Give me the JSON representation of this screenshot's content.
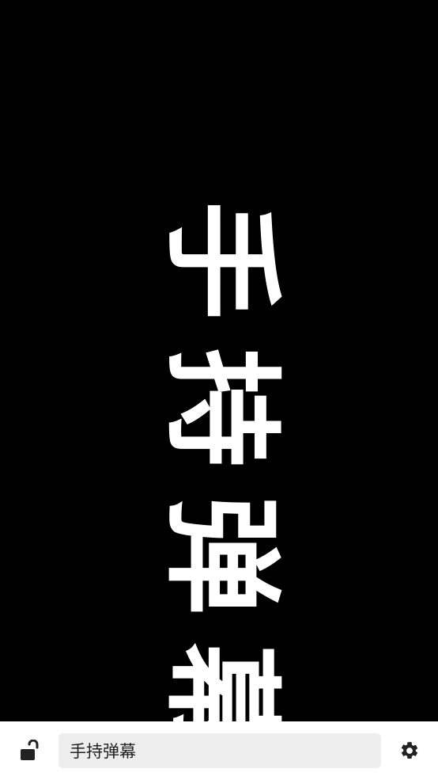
{
  "marquee": {
    "text": "手持弹幕",
    "text_color": "#ffffff",
    "background_color": "#000000"
  },
  "toolbar": {
    "lock_icon": "unlock-icon",
    "input_value": "手持弹幕",
    "settings_icon": "gear-icon",
    "background_color": "#ffffff",
    "input_background": "#eeeeee"
  }
}
